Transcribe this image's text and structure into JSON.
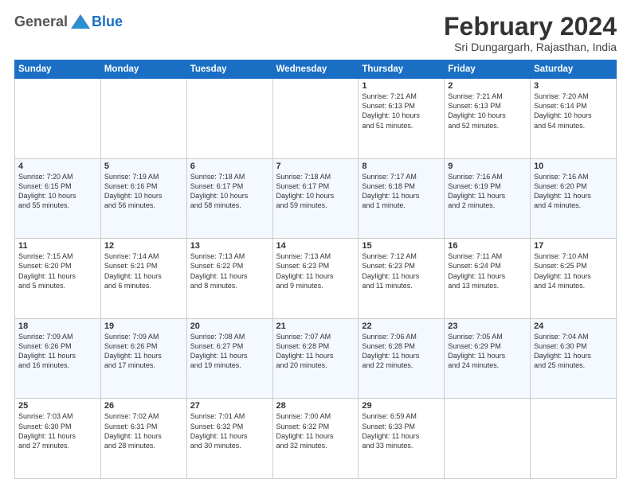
{
  "header": {
    "logo_general": "General",
    "logo_blue": "Blue",
    "month_title": "February 2024",
    "subtitle": "Sri Dungargarh, Rajasthan, India"
  },
  "days_of_week": [
    "Sunday",
    "Monday",
    "Tuesday",
    "Wednesday",
    "Thursday",
    "Friday",
    "Saturday"
  ],
  "weeks": [
    [
      {
        "day": "",
        "info": ""
      },
      {
        "day": "",
        "info": ""
      },
      {
        "day": "",
        "info": ""
      },
      {
        "day": "",
        "info": ""
      },
      {
        "day": "1",
        "info": "Sunrise: 7:21 AM\nSunset: 6:13 PM\nDaylight: 10 hours\nand 51 minutes."
      },
      {
        "day": "2",
        "info": "Sunrise: 7:21 AM\nSunset: 6:13 PM\nDaylight: 10 hours\nand 52 minutes."
      },
      {
        "day": "3",
        "info": "Sunrise: 7:20 AM\nSunset: 6:14 PM\nDaylight: 10 hours\nand 54 minutes."
      }
    ],
    [
      {
        "day": "4",
        "info": "Sunrise: 7:20 AM\nSunset: 6:15 PM\nDaylight: 10 hours\nand 55 minutes."
      },
      {
        "day": "5",
        "info": "Sunrise: 7:19 AM\nSunset: 6:16 PM\nDaylight: 10 hours\nand 56 minutes."
      },
      {
        "day": "6",
        "info": "Sunrise: 7:18 AM\nSunset: 6:17 PM\nDaylight: 10 hours\nand 58 minutes."
      },
      {
        "day": "7",
        "info": "Sunrise: 7:18 AM\nSunset: 6:17 PM\nDaylight: 10 hours\nand 59 minutes."
      },
      {
        "day": "8",
        "info": "Sunrise: 7:17 AM\nSunset: 6:18 PM\nDaylight: 11 hours\nand 1 minute."
      },
      {
        "day": "9",
        "info": "Sunrise: 7:16 AM\nSunset: 6:19 PM\nDaylight: 11 hours\nand 2 minutes."
      },
      {
        "day": "10",
        "info": "Sunrise: 7:16 AM\nSunset: 6:20 PM\nDaylight: 11 hours\nand 4 minutes."
      }
    ],
    [
      {
        "day": "11",
        "info": "Sunrise: 7:15 AM\nSunset: 6:20 PM\nDaylight: 11 hours\nand 5 minutes."
      },
      {
        "day": "12",
        "info": "Sunrise: 7:14 AM\nSunset: 6:21 PM\nDaylight: 11 hours\nand 6 minutes."
      },
      {
        "day": "13",
        "info": "Sunrise: 7:13 AM\nSunset: 6:22 PM\nDaylight: 11 hours\nand 8 minutes."
      },
      {
        "day": "14",
        "info": "Sunrise: 7:13 AM\nSunset: 6:23 PM\nDaylight: 11 hours\nand 9 minutes."
      },
      {
        "day": "15",
        "info": "Sunrise: 7:12 AM\nSunset: 6:23 PM\nDaylight: 11 hours\nand 11 minutes."
      },
      {
        "day": "16",
        "info": "Sunrise: 7:11 AM\nSunset: 6:24 PM\nDaylight: 11 hours\nand 13 minutes."
      },
      {
        "day": "17",
        "info": "Sunrise: 7:10 AM\nSunset: 6:25 PM\nDaylight: 11 hours\nand 14 minutes."
      }
    ],
    [
      {
        "day": "18",
        "info": "Sunrise: 7:09 AM\nSunset: 6:26 PM\nDaylight: 11 hours\nand 16 minutes."
      },
      {
        "day": "19",
        "info": "Sunrise: 7:09 AM\nSunset: 6:26 PM\nDaylight: 11 hours\nand 17 minutes."
      },
      {
        "day": "20",
        "info": "Sunrise: 7:08 AM\nSunset: 6:27 PM\nDaylight: 11 hours\nand 19 minutes."
      },
      {
        "day": "21",
        "info": "Sunrise: 7:07 AM\nSunset: 6:28 PM\nDaylight: 11 hours\nand 20 minutes."
      },
      {
        "day": "22",
        "info": "Sunrise: 7:06 AM\nSunset: 6:28 PM\nDaylight: 11 hours\nand 22 minutes."
      },
      {
        "day": "23",
        "info": "Sunrise: 7:05 AM\nSunset: 6:29 PM\nDaylight: 11 hours\nand 24 minutes."
      },
      {
        "day": "24",
        "info": "Sunrise: 7:04 AM\nSunset: 6:30 PM\nDaylight: 11 hours\nand 25 minutes."
      }
    ],
    [
      {
        "day": "25",
        "info": "Sunrise: 7:03 AM\nSunset: 6:30 PM\nDaylight: 11 hours\nand 27 minutes."
      },
      {
        "day": "26",
        "info": "Sunrise: 7:02 AM\nSunset: 6:31 PM\nDaylight: 11 hours\nand 28 minutes."
      },
      {
        "day": "27",
        "info": "Sunrise: 7:01 AM\nSunset: 6:32 PM\nDaylight: 11 hours\nand 30 minutes."
      },
      {
        "day": "28",
        "info": "Sunrise: 7:00 AM\nSunset: 6:32 PM\nDaylight: 11 hours\nand 32 minutes."
      },
      {
        "day": "29",
        "info": "Sunrise: 6:59 AM\nSunset: 6:33 PM\nDaylight: 11 hours\nand 33 minutes."
      },
      {
        "day": "",
        "info": ""
      },
      {
        "day": "",
        "info": ""
      }
    ]
  ]
}
